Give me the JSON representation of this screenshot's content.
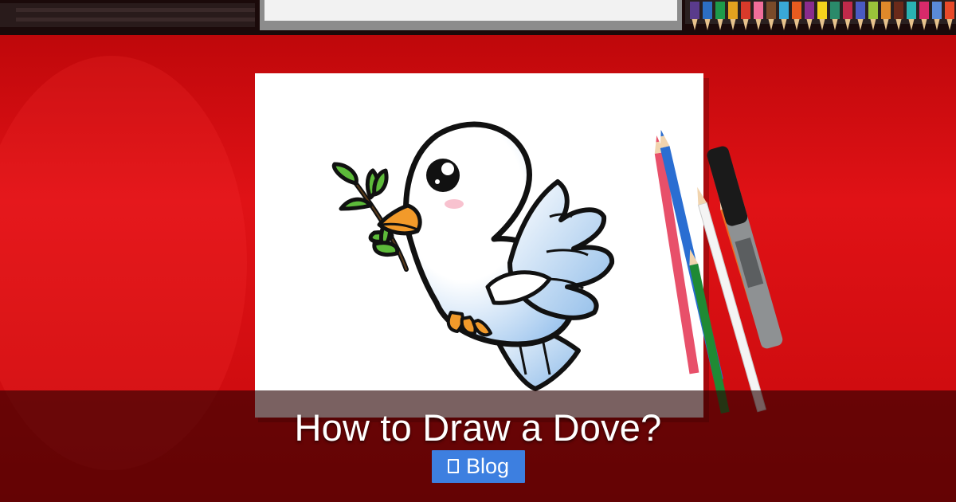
{
  "title": "How to Draw a Dove?",
  "badge": {
    "label": "Blog",
    "icon": "box-icon"
  },
  "colors": {
    "table_red": "#d10a0e",
    "badge_blue": "#3d7fe0",
    "paper": "#ffffff"
  }
}
